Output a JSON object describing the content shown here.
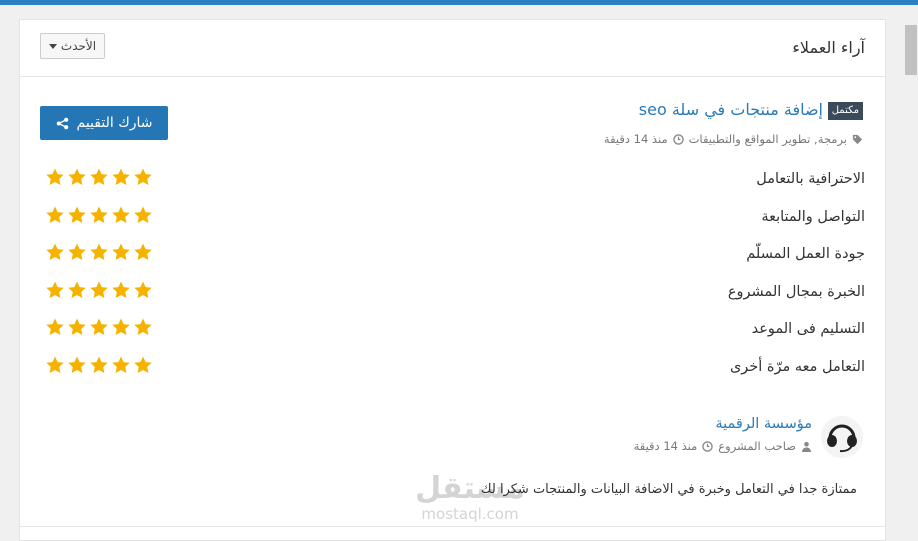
{
  "header": {
    "title": "آراء العملاء",
    "sort_label": "الأحدث"
  },
  "project": {
    "badge": "مكتمل",
    "title": "إضافة منتجات في سلة seo",
    "tags": "برمجة, تطوير المواقع والتطبيقات",
    "time": "منذ 14 دقيقة",
    "share_label": "شارك التقييم"
  },
  "ratings": [
    {
      "label": "الاحترافية بالتعامل",
      "stars": 5
    },
    {
      "label": "التواصل والمتابعة",
      "stars": 5
    },
    {
      "label": "جودة العمل المسلّم",
      "stars": 5
    },
    {
      "label": "الخبرة بمجال المشروع",
      "stars": 5
    },
    {
      "label": "التسليم فى الموعد",
      "stars": 5
    },
    {
      "label": "التعامل معه مرّة أخرى",
      "stars": 5
    }
  ],
  "review": {
    "owner_name": "مؤسسة الرقمية",
    "role": "صاحب المشروع",
    "time": "منذ 14 دقيقة",
    "comment": "ممتازة جدا في التعامل وخبرة في الاضافة البيانات والمنتجات شكرا لك"
  },
  "watermark": {
    "arabic": "مستقل",
    "latin": "mostaql.com"
  },
  "colors": {
    "accent": "#2a80c3",
    "button": "#2476b5",
    "star": "#f5b300",
    "link": "#2a7ab8"
  }
}
